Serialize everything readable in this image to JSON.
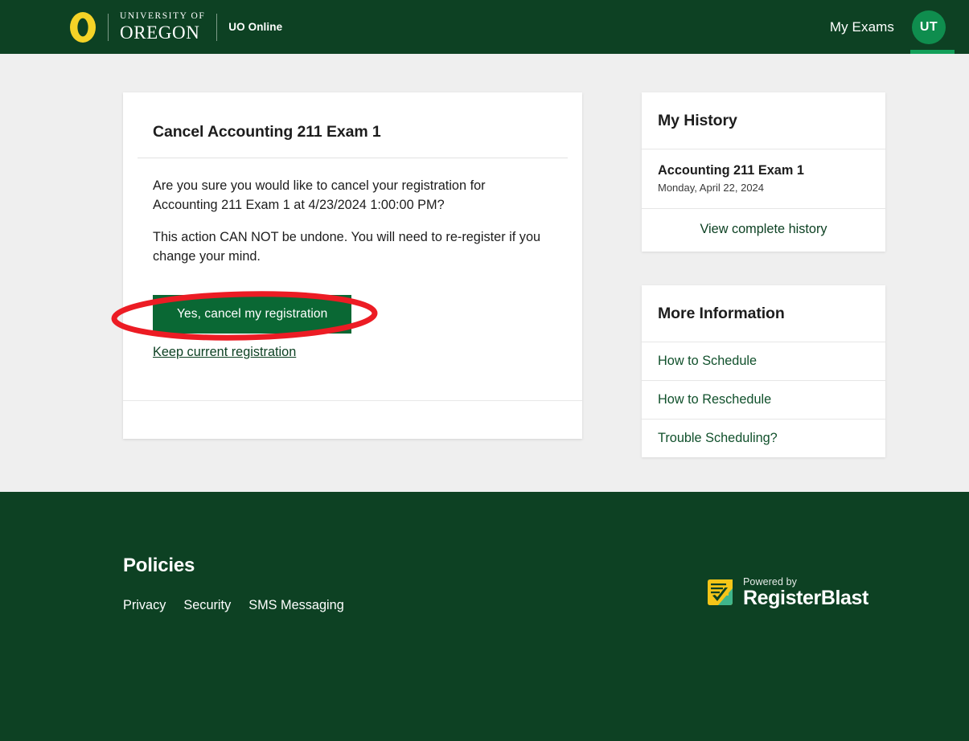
{
  "header": {
    "logo": {
      "letter": "O",
      "line1": "UNIVERSITY OF",
      "line2": "OREGON",
      "sub_brand": "UO Online"
    },
    "nav": {
      "my_exams": "My Exams"
    },
    "avatar_initials": "UT",
    "background_color": "#0d4123",
    "avatar_color": "#0f8d4e"
  },
  "main_card": {
    "title": "Cancel Accounting 211 Exam 1",
    "paragraph_1": "Are you sure you would like to cancel your registration for Accounting 211 Exam 1 at 4/23/2024 1:00:00 PM?",
    "paragraph_2": "This action CAN NOT be undone. You will need to re-register if you change your mind.",
    "confirm_button": "Yes, cancel my registration",
    "cancel_link": "Keep current registration",
    "button_color": "#0a6834"
  },
  "sidebar": {
    "history": {
      "heading": "My History",
      "items": [
        {
          "title": "Accounting 211 Exam 1",
          "date": "Monday, April 22, 2024"
        }
      ],
      "view_all_link": "View complete history"
    },
    "more_information": {
      "heading": "More Information",
      "links": [
        "How to Schedule",
        "How to Reschedule",
        "Trouble Scheduling?"
      ]
    }
  },
  "footer": {
    "policies_heading": "Policies",
    "links": [
      "Privacy",
      "Security",
      "SMS Messaging"
    ],
    "powered_by": "Powered by",
    "brand_name": "RegisterBlast",
    "background_color": "#0d4123"
  },
  "annotation": {
    "type": "red-ellipse-highlight",
    "target": "Yes, cancel my registration",
    "color": "#ec1c24"
  }
}
